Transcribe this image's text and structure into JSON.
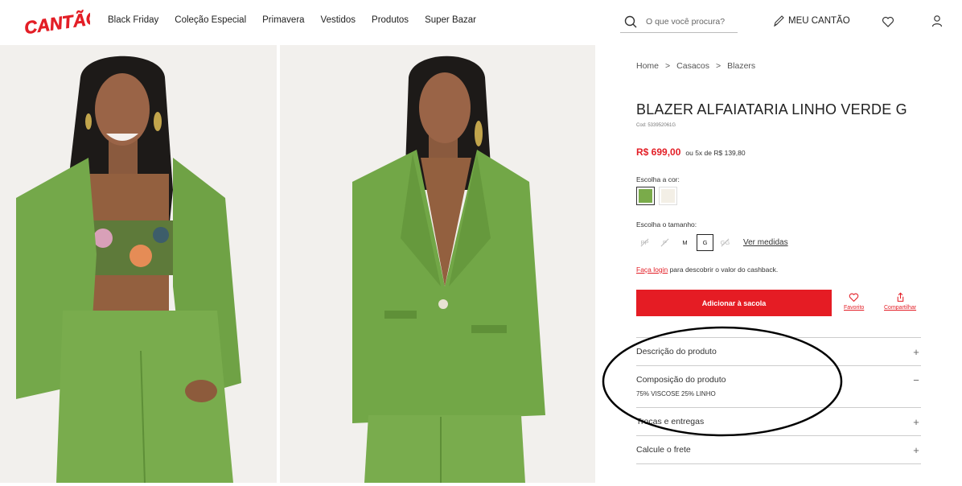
{
  "header": {
    "logo_text": "CANTÃO",
    "nav": [
      "Black Friday",
      "Coleção Especial",
      "Primavera",
      "Vestidos",
      "Produtos",
      "Super Bazar"
    ],
    "search_placeholder": "O que você procura?",
    "account_label": "MEU CANTÃO"
  },
  "breadcrumb": [
    "Home",
    ">",
    "Casacos",
    ">",
    "Blazers"
  ],
  "product": {
    "title": "BLAZER ALFAIATARIA LINHO VERDE G",
    "code": "Cod: 533952061G",
    "price": "R$ 699,00",
    "installments": "ou 5x de R$ 139,80",
    "color_label": "Escolha a cor:",
    "size_label": "Escolha o tamanho:",
    "sizes": [
      {
        "label": "PP",
        "state": "unavailable"
      },
      {
        "label": "P",
        "state": "unavailable"
      },
      {
        "label": "M",
        "state": "available"
      },
      {
        "label": "G",
        "state": "selected"
      },
      {
        "label": "GG",
        "state": "unavailable"
      }
    ],
    "size_guide": "Ver medidas",
    "cashback_link": "Faça login",
    "cashback_text": " para descobrir o valor do cashback.",
    "add_to_bag": "Adicionar à sacola",
    "favorite": "Favorito",
    "share": "Compartilhar"
  },
  "accordion": [
    {
      "title": "Descrição do produto",
      "sign": "+",
      "body": ""
    },
    {
      "title": "Composição do produto",
      "sign": "−",
      "body": "75% VISCOSE 25% LINHO"
    },
    {
      "title": "Trocas e entregas",
      "sign": "+",
      "body": ""
    },
    {
      "title": "Calcule o frete",
      "sign": "+",
      "body": ""
    }
  ],
  "colors": {
    "accent": "#e51c24",
    "swatch_green": "#7aab4a",
    "swatch_white": "#f3efe6"
  },
  "icons": [
    "search-icon",
    "pen-icon",
    "heart-icon",
    "user-icon",
    "share-icon",
    "plus-icon",
    "minus-icon"
  ]
}
